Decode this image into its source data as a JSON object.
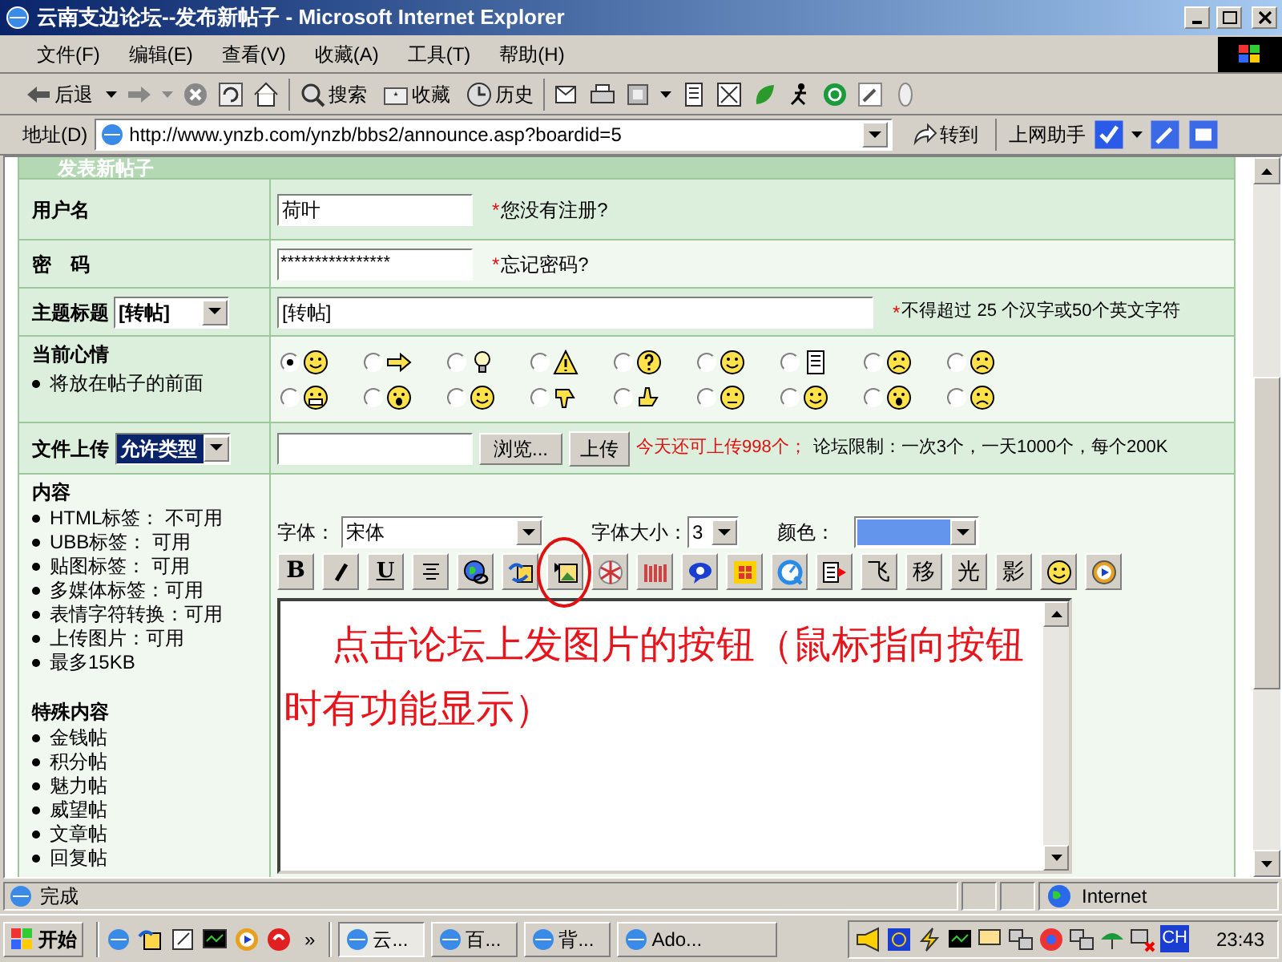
{
  "window": {
    "title": "云南支边论坛--发布新帖子 - Microsoft Internet Explorer"
  },
  "menu": [
    {
      "label": "文件(F)"
    },
    {
      "label": "编辑(E)"
    },
    {
      "label": "查看(V)"
    },
    {
      "label": "收藏(A)"
    },
    {
      "label": "工具(T)"
    },
    {
      "label": "帮助(H)"
    }
  ],
  "toolbar": {
    "back": "后退",
    "search": "搜索",
    "favorites": "收藏",
    "history": "历史"
  },
  "address": {
    "label": "地址(D)",
    "url": "http://www.ynzb.com/ynzb/bbs2/announce.asp?boardid=5",
    "go": "转到",
    "helper": "上网助手"
  },
  "form": {
    "header": "发表新帖子",
    "username": {
      "label": "用户名",
      "value": "荷叶",
      "marker": "*",
      "note": "您没有注册?"
    },
    "password": {
      "label": "密　码",
      "value": "****************",
      "marker": "*",
      "note": "忘记密码?"
    },
    "subject": {
      "label": "主题标题",
      "prefix": "[转帖]",
      "value": "[转帖]",
      "marker": "*",
      "note": "不得超过 25 个汉字或50个英文字符"
    },
    "mood": {
      "label": "当前心情",
      "hint": "将放在帖子的前面",
      "options": [
        {
          "selected": true
        },
        {
          "selected": false
        },
        {
          "selected": false
        },
        {
          "selected": false
        },
        {
          "selected": false
        },
        {
          "selected": false
        },
        {
          "selected": false
        },
        {
          "selected": false
        },
        {
          "selected": false
        },
        {
          "selected": false
        },
        {
          "selected": false
        },
        {
          "selected": false
        },
        {
          "selected": false
        },
        {
          "selected": false
        },
        {
          "selected": false
        },
        {
          "selected": false
        },
        {
          "selected": false
        },
        {
          "selected": false
        }
      ]
    },
    "upload": {
      "label": "文件上传",
      "type": "允许类型",
      "browse": "浏览...",
      "upload": "上传",
      "remaining": "今天还可上传998个；",
      "limit": "论坛限制：一次3个，一天1000个，每个200K"
    },
    "content": {
      "label": "内容",
      "rules": [
        "HTML标签： 不可用",
        "UBB标签： 可用",
        "贴图标签： 可用",
        "多媒体标签：可用",
        "表情字符转换：可用",
        "上传图片：可用",
        "最多15KB"
      ],
      "special_label": "特殊内容",
      "special": [
        "金钱帖",
        "积分帖",
        "魅力帖",
        "威望帖",
        "文章帖",
        "回复帖"
      ],
      "font_label": "字体：",
      "font": "宋体",
      "size_label": "字体大小：",
      "size": "3",
      "color_label": "颜色：",
      "color": "#6495ed",
      "buttons": [
        {
          "kind": "bold",
          "label": "B",
          "circled": false
        },
        {
          "kind": "italic",
          "circled": false
        },
        {
          "kind": "underline",
          "label": "U",
          "circled": false
        },
        {
          "kind": "center",
          "circled": false
        },
        {
          "kind": "link",
          "circled": false
        },
        {
          "kind": "swap",
          "circled": false
        },
        {
          "kind": "image",
          "circled": true
        },
        {
          "kind": "flash",
          "circled": false
        },
        {
          "kind": "bars",
          "circled": false
        },
        {
          "kind": "eye",
          "circled": false
        },
        {
          "kind": "media",
          "circled": false
        },
        {
          "kind": "quicktime",
          "circled": false
        },
        {
          "kind": "doc",
          "circled": false
        },
        {
          "kind": "text",
          "label": "飞",
          "circled": false
        },
        {
          "kind": "text",
          "label": "移",
          "circled": false
        },
        {
          "kind": "text",
          "label": "光",
          "circled": false
        },
        {
          "kind": "text",
          "label": "影",
          "circled": false
        },
        {
          "kind": "smiley",
          "circled": false
        },
        {
          "kind": "play",
          "circled": false
        }
      ],
      "body": "点击论坛上发图片的按钮（鼠标指向按钮时有功能显示）"
    }
  },
  "status_bar": {
    "text": "完成",
    "zone": "Internet"
  },
  "taskbar": {
    "start": "开始",
    "more": "»",
    "tasks": [
      {
        "label": "云...",
        "selected": true
      },
      {
        "label": "百...",
        "selected": false
      },
      {
        "label": "背...",
        "selected": false
      },
      {
        "label": "Ado...",
        "selected": false
      }
    ],
    "lang": "CH",
    "clock": "23:43"
  }
}
